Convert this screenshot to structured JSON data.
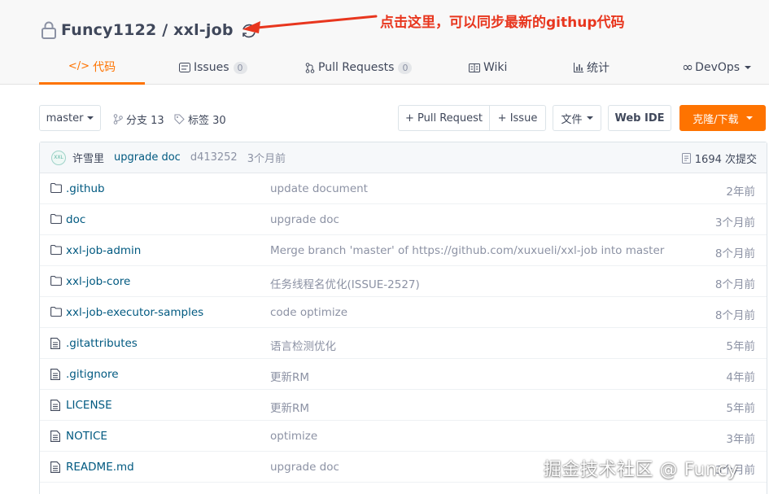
{
  "repo": {
    "title": "Funcy1122 / xxl-job"
  },
  "annotation": {
    "text": "点击这里，可以同步最新的githup代码",
    "color": "#e8361e"
  },
  "tabs": [
    {
      "label": "代码",
      "icon": "code-icon",
      "active": true
    },
    {
      "label": "Issues",
      "count": "0",
      "icon": "issues-icon"
    },
    {
      "label": "Pull Requests",
      "count": "0",
      "icon": "pull-request-icon"
    },
    {
      "label": "Wiki",
      "icon": "wiki-icon"
    },
    {
      "label": "统计",
      "icon": "stats-icon"
    },
    {
      "label": "DevOps",
      "icon": "devops-icon"
    }
  ],
  "toolbar": {
    "branch": "master",
    "branches_label": "分支 13",
    "tags_label": "标签 30",
    "pull_request_button": "+ Pull Request",
    "issue_button": "+ Issue",
    "file_button": "文件",
    "web_ide_button": "Web IDE",
    "clone_button": "克隆/下载"
  },
  "commit": {
    "avatar": "XXL",
    "author": "许雪里",
    "message": "upgrade doc",
    "sha": "d413252",
    "time": "3个月前",
    "total": "1694 次提交"
  },
  "files": [
    {
      "type": "folder",
      "name": ".github",
      "message": "update document",
      "time": "2年前"
    },
    {
      "type": "folder",
      "name": "doc",
      "message": "upgrade doc",
      "time": "3个月前"
    },
    {
      "type": "folder",
      "name": "xxl-job-admin",
      "message": "Merge branch 'master' of https://github.com/xuxueli/xxl-job into master",
      "time": "8个月前"
    },
    {
      "type": "folder",
      "name": "xxl-job-core",
      "message": "任务线程名优化(ISSUE-2527)",
      "time": "8个月前"
    },
    {
      "type": "folder",
      "name": "xxl-job-executor-samples",
      "message": "code optimize",
      "time": "8个月前"
    },
    {
      "type": "file",
      "name": ".gitattributes",
      "message": "语言检测优化",
      "time": "5年前"
    },
    {
      "type": "file",
      "name": ".gitignore",
      "message": "更新RM",
      "time": "4年前"
    },
    {
      "type": "file",
      "name": "LICENSE",
      "message": "更新RM",
      "time": "5年前"
    },
    {
      "type": "file",
      "name": "NOTICE",
      "message": "optimize",
      "time": "3年前"
    },
    {
      "type": "file",
      "name": "README.md",
      "message": "upgrade doc",
      "time": "3个月前"
    }
  ],
  "watermark": "掘金技术社区 @ Funcy",
  "colors": {
    "accent": "#fe7300",
    "link": "#005980",
    "muted": "#8c92a4"
  }
}
